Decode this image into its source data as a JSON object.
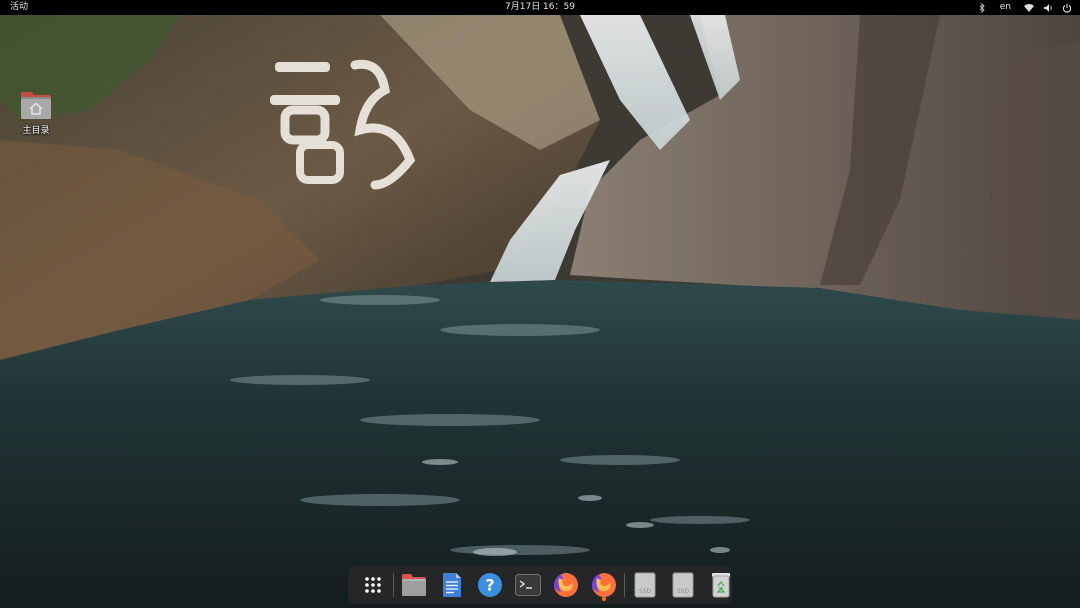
{
  "topbar": {
    "activities_label": "活动",
    "clock": "7月17日  16：59",
    "language": "en",
    "tray_icons": [
      "bluetooth-icon",
      "wifi-icon",
      "volume-icon",
      "power-icon"
    ]
  },
  "desktop": {
    "icons": [
      {
        "label": "主目录",
        "icon": "home-folder-icon"
      }
    ]
  },
  "dock": {
    "items": [
      {
        "name": "show-apps",
        "icon": "app-grid-icon"
      },
      {
        "name": "files",
        "icon": "folder-icon"
      },
      {
        "name": "text-editor",
        "icon": "document-icon"
      },
      {
        "name": "help",
        "icon": "help-icon",
        "glyph": "?"
      },
      {
        "name": "terminal",
        "icon": "terminal-icon",
        "glyph": ">_"
      },
      {
        "name": "firefox",
        "icon": "firefox-icon"
      },
      {
        "name": "firefox-running",
        "icon": "firefox-icon",
        "running": true
      },
      {
        "name": "drive-1",
        "icon": "ssd-drive-icon",
        "label": "SSD"
      },
      {
        "name": "drive-2",
        "icon": "ssd-drive-icon",
        "label": "SSD"
      },
      {
        "name": "trash",
        "icon": "trash-icon"
      }
    ]
  },
  "colors": {
    "topbar_bg": "#000000",
    "dock_bg": "#282828",
    "help_blue": "#3a8fe0",
    "firefox_orange": "#ff7b00",
    "folder_red": "#d9534f"
  }
}
